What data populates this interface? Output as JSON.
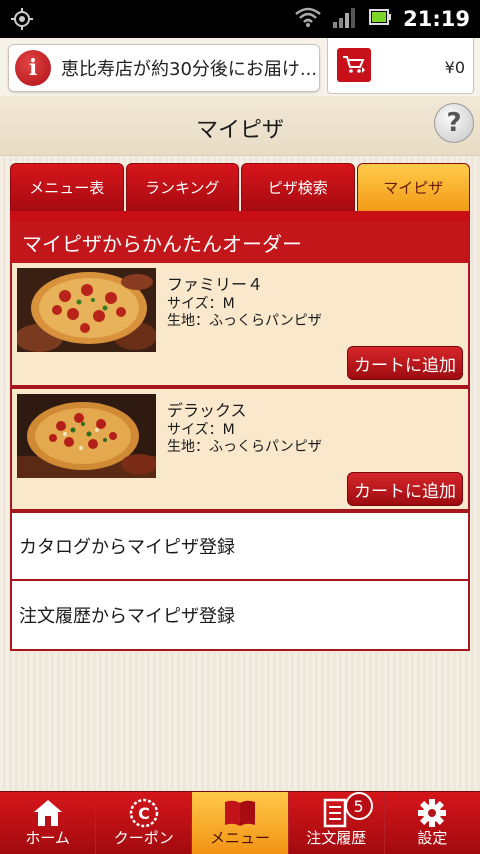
{
  "status_bar": {
    "time": "21:19"
  },
  "delivery": {
    "text": "恵比寿店が約30分後にお届け..."
  },
  "cart": {
    "total": "¥0"
  },
  "header": {
    "title": "マイピザ",
    "help_label": "?"
  },
  "tabs": [
    {
      "label": "メニュー表",
      "active": false
    },
    {
      "label": "ランキング",
      "active": false
    },
    {
      "label": "ピザ検索",
      "active": false
    },
    {
      "label": "マイピザ",
      "active": true
    }
  ],
  "section": {
    "title": "マイピザからかんたんオーダー"
  },
  "pizzas": [
    {
      "name": "ファミリー４",
      "size": "サイズ：M",
      "crust": "生地：ふっくらパンピザ",
      "button": "カートに追加"
    },
    {
      "name": "デラックス",
      "size": "サイズ：M",
      "crust": "生地：ふっくらパンピザ",
      "button": "カートに追加"
    }
  ],
  "links": [
    {
      "label": "カタログからマイピザ登録"
    },
    {
      "label": "注文履歴からマイピザ登録"
    }
  ],
  "nav": [
    {
      "label": "ホーム",
      "icon": "home-icon"
    },
    {
      "label": "クーポン",
      "icon": "coupon-icon"
    },
    {
      "label": "メニュー",
      "icon": "menu-book-icon",
      "active": true
    },
    {
      "label": "注文履歴",
      "icon": "order-history-icon",
      "badge": "5"
    },
    {
      "label": "設定",
      "icon": "settings-gear-icon"
    }
  ],
  "colors": {
    "brand_red": "#c2161b",
    "active_tab": "#f29a17",
    "card_bg": "#f9e8cc"
  }
}
